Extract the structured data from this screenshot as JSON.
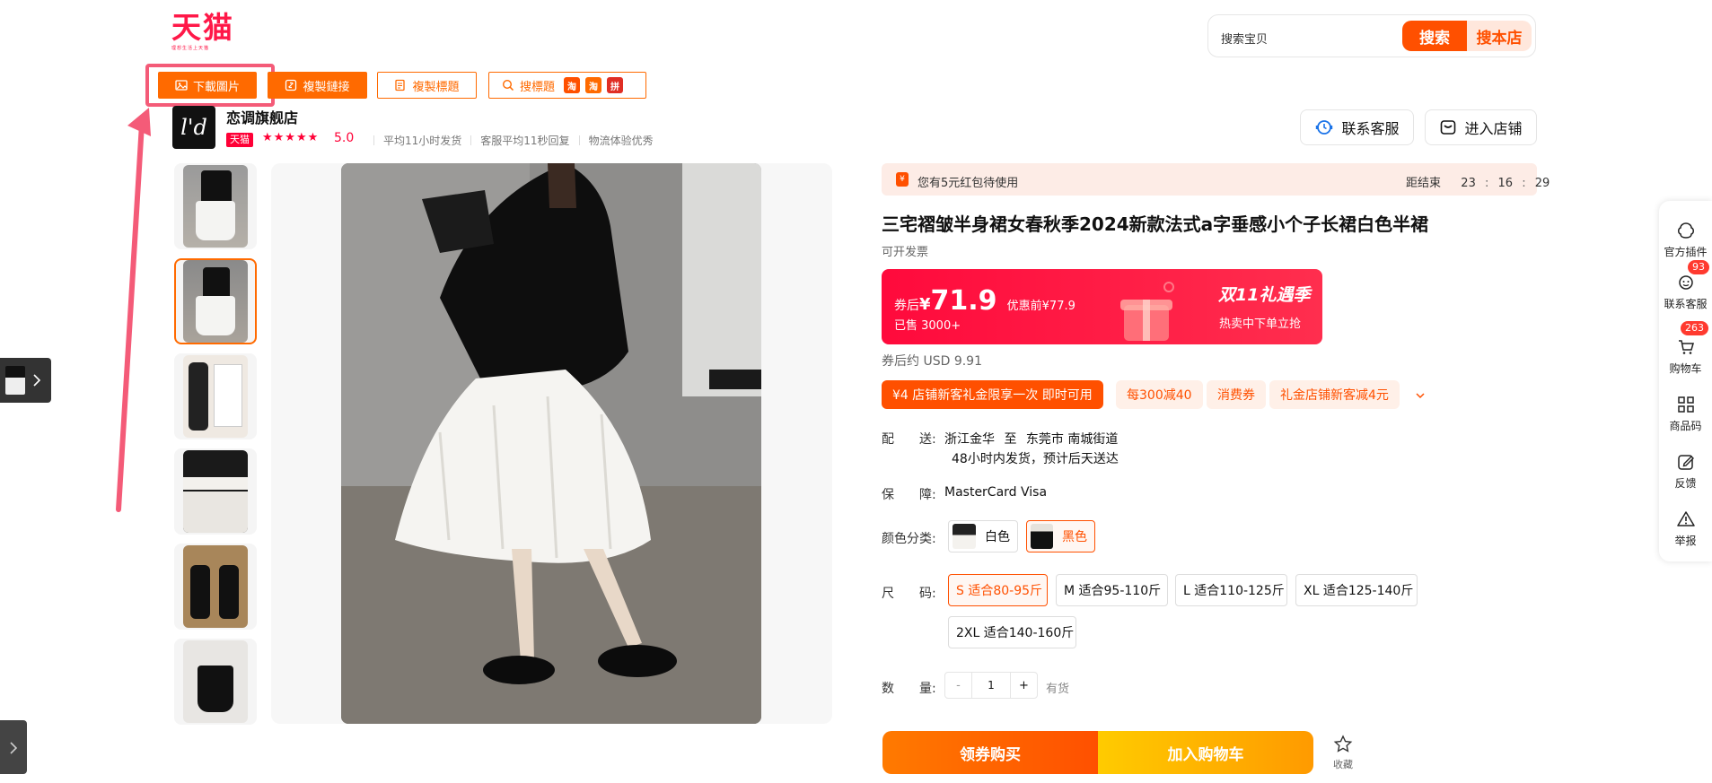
{
  "header": {
    "logo_text": "天猫",
    "logo_tagline": "理想生活上天猫",
    "search_placeholder": "搜索宝贝",
    "search_button": "搜索",
    "search_store_button": "搜本店"
  },
  "toolbar": {
    "download_images": "下載圖片",
    "copy_link": "複製鏈接",
    "copy_title": "複製標題",
    "search_title": "搜標題",
    "mini_icons": [
      "淘",
      "淘",
      "拼"
    ]
  },
  "shop": {
    "logo_text": "l'd",
    "name": "恋调旗舰店",
    "tmall_tag": "天猫",
    "stars": "★★★★★",
    "score": "5.0",
    "meta": [
      "平均11小时发货",
      "客服平均11秒回复",
      "物流体验优秀"
    ],
    "contact_label": "联系客服",
    "enter_store_label": "进入店铺"
  },
  "promo_bar": {
    "text": "您有5元红包待使用",
    "countdown_label": "距结束",
    "hh": "23",
    "mm": "16",
    "ss": "29"
  },
  "product": {
    "title": "三宅褶皱半身裙女春秋季2024新款法式a字垂感小个子长裙白色半裙",
    "invoice": "可开发票",
    "price_prefix": "券后",
    "currency": "¥",
    "price": "71.9",
    "original_price": "优惠前¥77.9",
    "sold": "已售 3000+",
    "banner_title": "双11礼遇季",
    "banner_sub": "热卖中下单立抢",
    "usd_label": "券后约 USD 9.91"
  },
  "coupons": [
    "¥4  店铺新客礼金限享一次 即时可用",
    "每300减40",
    "消费券",
    "礼金店铺新客减4元"
  ],
  "delivery": {
    "label_1": "配",
    "label_2": "送:",
    "from": "浙江金华",
    "to_word": "至",
    "to": "东莞市 南城街道",
    "note": "48小时内发货，预计后天送达"
  },
  "guarantee": {
    "label_1": "保",
    "label_2": "障:",
    "value": "MasterCard Visa"
  },
  "color": {
    "label": "颜色分类:",
    "options": [
      "白色",
      "黑色"
    ]
  },
  "size": {
    "label_1": "尺",
    "label_2": "码:",
    "options": [
      "S 适合80-95斤",
      "M 适合95-110斤",
      "L 适合110-125斤",
      "XL 适合125-140斤",
      "2XL 适合140-160斤"
    ]
  },
  "quantity": {
    "label_1": "数",
    "label_2": "量:",
    "minus": "-",
    "value": "1",
    "plus": "+",
    "stock": "有货"
  },
  "actions": {
    "buy": "领券购买",
    "add_cart": "加入购物车",
    "favorite": "收藏"
  },
  "sidebar": {
    "items": [
      "官方插件",
      "联系客服",
      "购物车",
      "商品码",
      "反馈",
      "举报"
    ],
    "service_badge": "93",
    "cart_badge": "263"
  },
  "colors": {
    "tmall_red": "#ff1848",
    "orange": "#ff5000",
    "toolbar_orange": "#ff6a00",
    "highlight_pink": "#f45b78"
  }
}
